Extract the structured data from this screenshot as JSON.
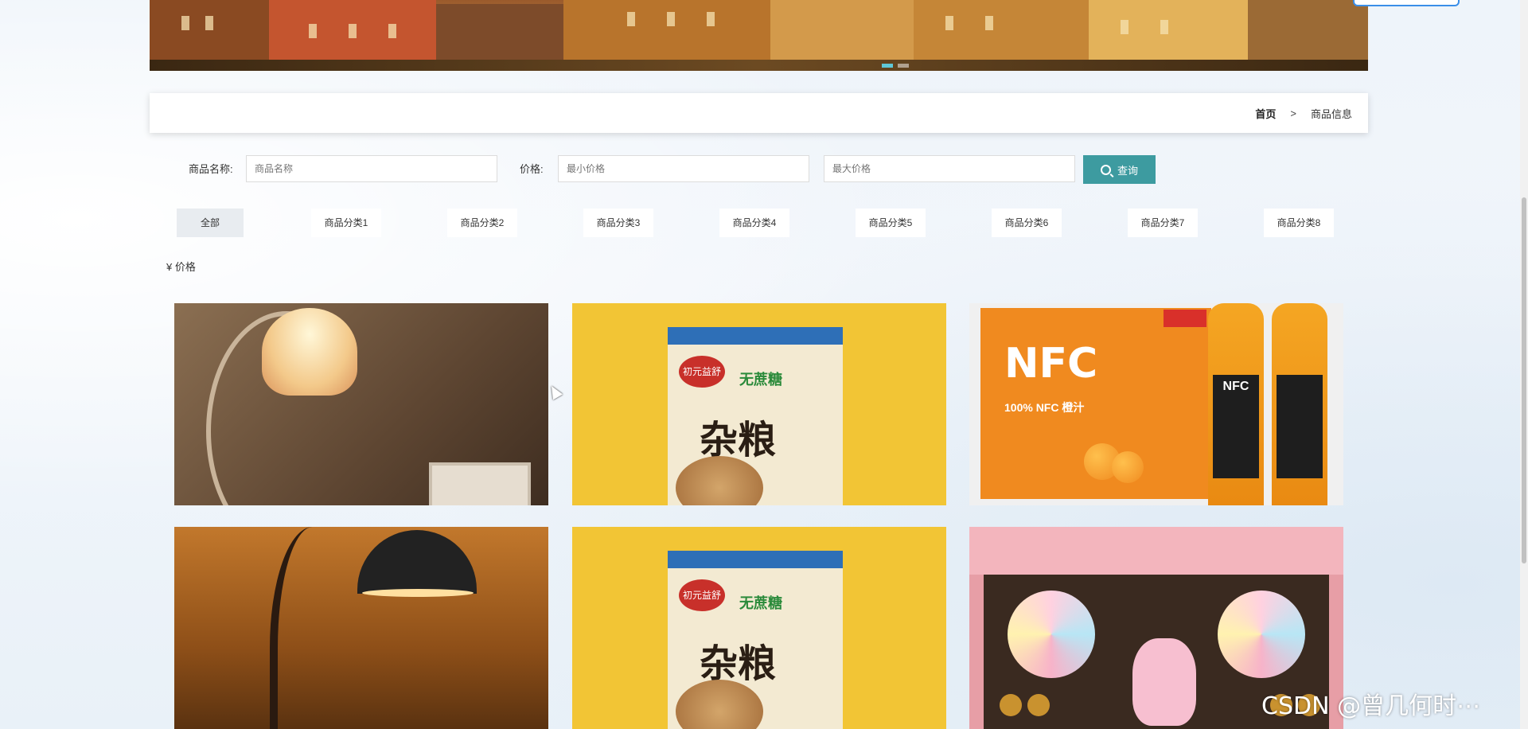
{
  "breadcrumb": {
    "home": "首页",
    "separator": ">",
    "current": "商品信息"
  },
  "search": {
    "name_label": "商品名称:",
    "name_placeholder": "商品名称",
    "price_label": "价格:",
    "min_placeholder": "最小价格",
    "max_placeholder": "最大价格",
    "button_label": "查询"
  },
  "categories": [
    "全部",
    "商品分类1",
    "商品分类2",
    "商品分类3",
    "商品分类4",
    "商品分类5",
    "商品分类6",
    "商品分类7",
    "商品分类8"
  ],
  "sort": {
    "price_label": "¥ 价格"
  },
  "products": [
    {
      "image": "table-lamp"
    },
    {
      "image": "grain-biscuit-box",
      "text": {
        "brand": "初元益舒",
        "sub": "无蔗糖",
        "title": "杂粮"
      }
    },
    {
      "image": "nfc-orange-juice",
      "text": {
        "logo": "NFC",
        "pct": "100% NFC 橙汁",
        "bottle": "NFC"
      }
    },
    {
      "image": "desk-lamp"
    },
    {
      "image": "grain-biscuit-box",
      "text": {
        "brand": "初元益舒",
        "sub": "无蔗糖",
        "title": "杂粮"
      }
    },
    {
      "image": "candy-gift-box"
    }
  ],
  "watermark": "CSDN @曾几何时⋯",
  "colors": {
    "accent": "#3d9ba0",
    "breadcrumb_bg": "#ffffff",
    "category_active_bg": "#e8ecf0"
  }
}
